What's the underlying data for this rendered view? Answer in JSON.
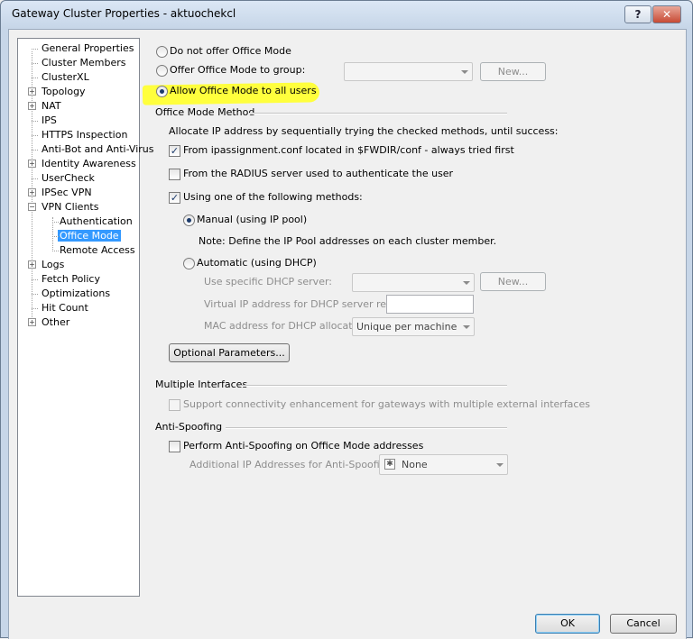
{
  "window": {
    "title": "Gateway Cluster Properties - aktuochekcl",
    "help_label": "?",
    "close_label": "✕"
  },
  "tree": [
    {
      "label": "General Properties",
      "expandable": false
    },
    {
      "label": "Cluster Members",
      "expandable": false
    },
    {
      "label": "ClusterXL",
      "expandable": false
    },
    {
      "label": "Topology",
      "expandable": true
    },
    {
      "label": "NAT",
      "expandable": true
    },
    {
      "label": "IPS",
      "expandable": false
    },
    {
      "label": "HTTPS Inspection",
      "expandable": false
    },
    {
      "label": "Anti-Bot and Anti-Virus",
      "expandable": false
    },
    {
      "label": "Identity Awareness",
      "expandable": true
    },
    {
      "label": "UserCheck",
      "expandable": false
    },
    {
      "label": "IPSec VPN",
      "expandable": true
    },
    {
      "label": "VPN Clients",
      "expandable": true,
      "expanded": true
    },
    {
      "label": "Authentication",
      "child": true
    },
    {
      "label": "Office Mode",
      "child": true,
      "selected": true
    },
    {
      "label": "Remote Access",
      "child": true
    },
    {
      "label": "Logs",
      "expandable": true
    },
    {
      "label": "Fetch Policy",
      "expandable": false
    },
    {
      "label": "Optimizations",
      "expandable": false
    },
    {
      "label": "Hit Count",
      "expandable": false
    },
    {
      "label": "Other",
      "expandable": true
    }
  ],
  "office_mode": {
    "radio_do_not_offer": "Do not offer Office Mode",
    "radio_offer_group": "Offer Office Mode to group:",
    "group_combo_value": "",
    "group_new_button": "New...",
    "radio_allow_all": "Allow Office Mode to all users",
    "selected_option": "allow_all",
    "method_section_title": "Office Mode Method",
    "allocate_text": "Allocate IP address by sequentially trying the checked methods, until success:",
    "ipassignment_check": "From ipassignment.conf located in $FWDIR/conf - always tried first",
    "ipassignment_checked": true,
    "radius_check": "From the RADIUS server used to authenticate the user",
    "radius_checked": false,
    "methods_check": "Using one of the following methods:",
    "methods_checked": true,
    "manual_radio": "Manual (using IP pool)",
    "manual_selected": true,
    "manual_note": "Note: Define the IP Pool addresses on each cluster member.",
    "auto_radio": "Automatic (using DHCP)",
    "dhcp_server_label": "Use specific DHCP server:",
    "dhcp_server_value": "",
    "dhcp_new_button": "New...",
    "virtual_ip_label": "Virtual IP address for DHCP server replies:",
    "virtual_ip_value": "",
    "mac_label": "MAC address for DHCP allocation:",
    "mac_value": "Unique per machine",
    "optional_params_button": "Optional Parameters...",
    "multiple_interfaces_title": "Multiple Interfaces",
    "multi_if_check": "Support connectivity enhancement for gateways with multiple external interfaces",
    "anti_spoofing_title": "Anti-Spoofing",
    "anti_spoof_check": "Perform Anti-Spoofing on Office Mode addresses",
    "anti_spoof_checked": false,
    "additional_ip_label": "Additional IP Addresses for Anti-Spoofing:",
    "additional_ip_value": "None"
  },
  "footer": {
    "ok_label": "OK",
    "cancel_label": "Cancel"
  },
  "colors": {
    "highlight": "#ffff33",
    "selection": "#3399ff"
  }
}
